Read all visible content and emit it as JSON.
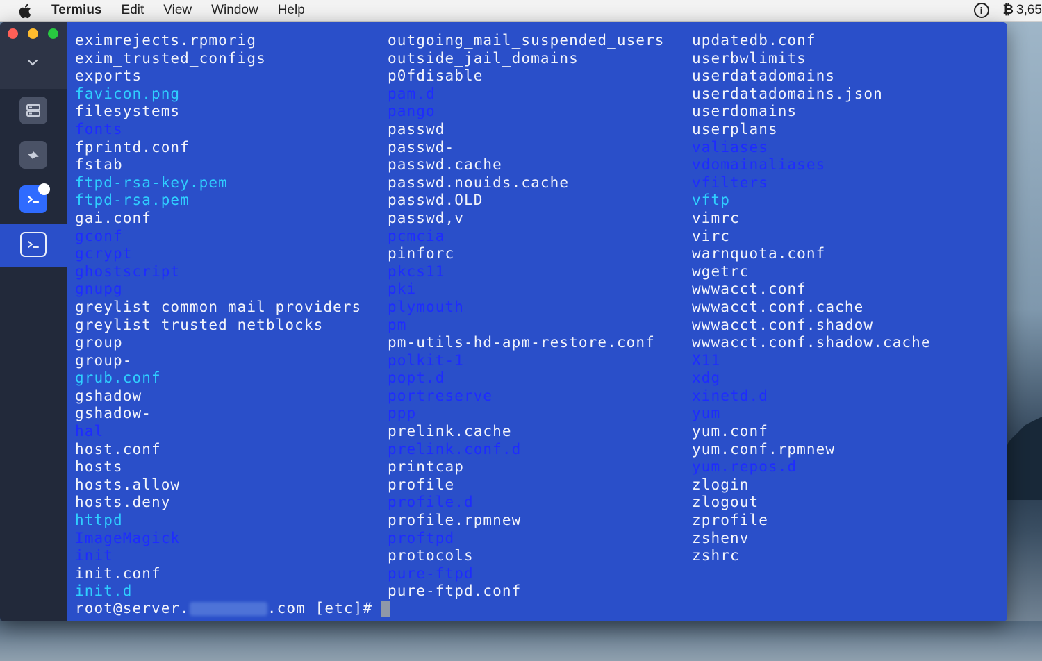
{
  "menubar": {
    "app_name": "Termius",
    "items": [
      "Edit",
      "View",
      "Window",
      "Help"
    ],
    "right": {
      "btc_symbol": "₿",
      "btc_value": "3,65"
    }
  },
  "colors": {
    "dir": "#1e2bff",
    "link": "#2fcfff",
    "file": "#f2f4fb",
    "bg": "#2a4fc9"
  },
  "terminal": {
    "columns": [
      [
        {
          "t": "eximrejects.rpmorig",
          "k": "f"
        },
        {
          "t": "exim_trusted_configs",
          "k": "f"
        },
        {
          "t": "exports",
          "k": "f"
        },
        {
          "t": "favicon.png",
          "k": "l"
        },
        {
          "t": "filesystems",
          "k": "f"
        },
        {
          "t": "fonts",
          "k": "d"
        },
        {
          "t": "fprintd.conf",
          "k": "f"
        },
        {
          "t": "fstab",
          "k": "f"
        },
        {
          "t": "ftpd-rsa-key.pem",
          "k": "l"
        },
        {
          "t": "ftpd-rsa.pem",
          "k": "l"
        },
        {
          "t": "gai.conf",
          "k": "f"
        },
        {
          "t": "gconf",
          "k": "d"
        },
        {
          "t": "gcrypt",
          "k": "d"
        },
        {
          "t": "ghostscript",
          "k": "d"
        },
        {
          "t": "gnupg",
          "k": "d"
        },
        {
          "t": "greylist_common_mail_providers",
          "k": "f"
        },
        {
          "t": "greylist_trusted_netblocks",
          "k": "f"
        },
        {
          "t": "group",
          "k": "f"
        },
        {
          "t": "group-",
          "k": "f"
        },
        {
          "t": "grub.conf",
          "k": "l"
        },
        {
          "t": "gshadow",
          "k": "f"
        },
        {
          "t": "gshadow-",
          "k": "f"
        },
        {
          "t": "hal",
          "k": "d"
        },
        {
          "t": "host.conf",
          "k": "f"
        },
        {
          "t": "hosts",
          "k": "f"
        },
        {
          "t": "hosts.allow",
          "k": "f"
        },
        {
          "t": "hosts.deny",
          "k": "f"
        },
        {
          "t": "httpd",
          "k": "l"
        },
        {
          "t": "ImageMagick",
          "k": "d"
        },
        {
          "t": "init",
          "k": "d"
        },
        {
          "t": "init.conf",
          "k": "f"
        },
        {
          "t": "init.d",
          "k": "l"
        }
      ],
      [
        {
          "t": "outgoing_mail_suspended_users",
          "k": "f"
        },
        {
          "t": "outside_jail_domains",
          "k": "f"
        },
        {
          "t": "p0fdisable",
          "k": "f"
        },
        {
          "t": "pam.d",
          "k": "d"
        },
        {
          "t": "pango",
          "k": "d"
        },
        {
          "t": "passwd",
          "k": "f"
        },
        {
          "t": "passwd-",
          "k": "f"
        },
        {
          "t": "passwd.cache",
          "k": "f"
        },
        {
          "t": "passwd.nouids.cache",
          "k": "f"
        },
        {
          "t": "passwd.OLD",
          "k": "f"
        },
        {
          "t": "passwd,v",
          "k": "f"
        },
        {
          "t": "pcmcia",
          "k": "d"
        },
        {
          "t": "pinforc",
          "k": "f"
        },
        {
          "t": "pkcs11",
          "k": "d"
        },
        {
          "t": "pki",
          "k": "d"
        },
        {
          "t": "plymouth",
          "k": "d"
        },
        {
          "t": "pm",
          "k": "d"
        },
        {
          "t": "pm-utils-hd-apm-restore.conf",
          "k": "f"
        },
        {
          "t": "polkit-1",
          "k": "d"
        },
        {
          "t": "popt.d",
          "k": "d"
        },
        {
          "t": "portreserve",
          "k": "d"
        },
        {
          "t": "ppp",
          "k": "d"
        },
        {
          "t": "prelink.cache",
          "k": "f"
        },
        {
          "t": "prelink.conf.d",
          "k": "d"
        },
        {
          "t": "printcap",
          "k": "f"
        },
        {
          "t": "profile",
          "k": "f"
        },
        {
          "t": "profile.d",
          "k": "d"
        },
        {
          "t": "profile.rpmnew",
          "k": "f"
        },
        {
          "t": "proftpd",
          "k": "d"
        },
        {
          "t": "protocols",
          "k": "f"
        },
        {
          "t": "pure-ftpd",
          "k": "d"
        },
        {
          "t": "pure-ftpd.conf",
          "k": "f"
        }
      ],
      [
        {
          "t": "updatedb.conf",
          "k": "f"
        },
        {
          "t": "userbwlimits",
          "k": "f"
        },
        {
          "t": "userdatadomains",
          "k": "f"
        },
        {
          "t": "userdatadomains.json",
          "k": "f"
        },
        {
          "t": "userdomains",
          "k": "f"
        },
        {
          "t": "userplans",
          "k": "f"
        },
        {
          "t": "valiases",
          "k": "d"
        },
        {
          "t": "vdomainaliases",
          "k": "d"
        },
        {
          "t": "vfilters",
          "k": "d"
        },
        {
          "t": "vftp",
          "k": "l"
        },
        {
          "t": "vimrc",
          "k": "f"
        },
        {
          "t": "virc",
          "k": "f"
        },
        {
          "t": "warnquota.conf",
          "k": "f"
        },
        {
          "t": "wgetrc",
          "k": "f"
        },
        {
          "t": "wwwacct.conf",
          "k": "f"
        },
        {
          "t": "wwwacct.conf.cache",
          "k": "f"
        },
        {
          "t": "wwwacct.conf.shadow",
          "k": "f"
        },
        {
          "t": "wwwacct.conf.shadow.cache",
          "k": "f"
        },
        {
          "t": "X11",
          "k": "d"
        },
        {
          "t": "xdg",
          "k": "d"
        },
        {
          "t": "xinetd.d",
          "k": "d"
        },
        {
          "t": "yum",
          "k": "d"
        },
        {
          "t": "yum.conf",
          "k": "f"
        },
        {
          "t": "yum.conf.rpmnew",
          "k": "f"
        },
        {
          "t": "yum.repos.d",
          "k": "d"
        },
        {
          "t": "zlogin",
          "k": "f"
        },
        {
          "t": "zlogout",
          "k": "f"
        },
        {
          "t": "zprofile",
          "k": "f"
        },
        {
          "t": "zshenv",
          "k": "f"
        },
        {
          "t": "zshrc",
          "k": "f"
        }
      ]
    ],
    "prompt": {
      "prefix": "root@server.",
      "suffix": ".com [etc]#"
    }
  }
}
